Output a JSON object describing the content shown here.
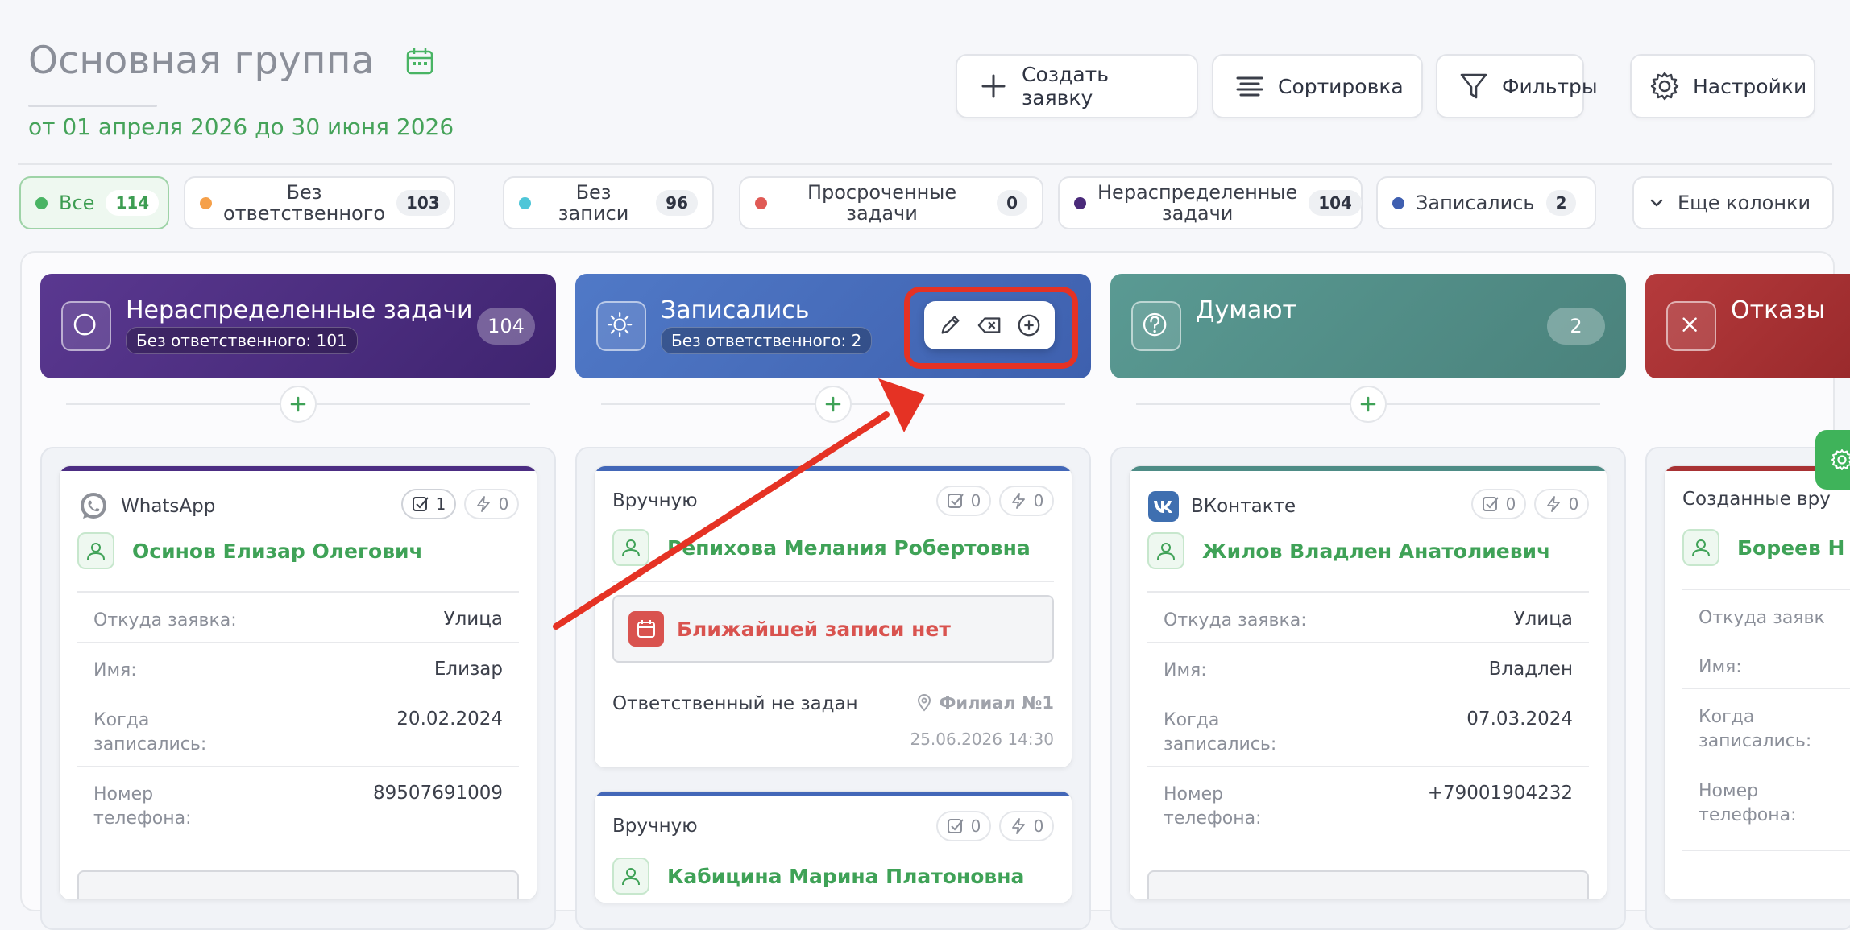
{
  "header": {
    "title": "Основная группа",
    "date_range": "от 01 апреля 2026 до 30 июня 2026"
  },
  "toolbar": {
    "create": "Создать заявку",
    "sort": "Сортировка",
    "filters": "Фильтры",
    "settings": "Настройки"
  },
  "chips": [
    {
      "label": "Все",
      "count": "114",
      "color": "#49b464"
    },
    {
      "label1": "Без",
      "label2": "ответственного",
      "count": "103",
      "color": "#f5a04a"
    },
    {
      "label": "Без записи",
      "count": "96",
      "color": "#4fc6d8"
    },
    {
      "label1": "Просроченные",
      "label2": "задачи",
      "count": "0",
      "color": "#e05a55"
    },
    {
      "label1": "Нераспределенные",
      "label2": "задачи",
      "count": "104",
      "color": "#4a2a7a"
    },
    {
      "label": "Записались",
      "count": "2",
      "color": "#3f5fb0"
    }
  ],
  "more_columns": "Еще колонки",
  "columns": [
    {
      "title": "Нераспределенные задачи",
      "sub": "Без ответственного: 101",
      "count": "104",
      "color": "#4c2d83"
    },
    {
      "title": "Записались",
      "sub": "Без ответственного: 2",
      "color": "#4367b8"
    },
    {
      "title": "Думают",
      "count": "2",
      "color": "#4e8c86"
    },
    {
      "title": "Отказы",
      "color": "#a83234"
    }
  ],
  "cards": {
    "c1": {
      "source": "WhatsApp",
      "tasks": "1",
      "events": "0",
      "name": "Осинов Елизар Олегович",
      "fields": [
        {
          "k1": "Откуда заявка:",
          "v": "Улица"
        },
        {
          "k1": "Имя:",
          "v": "Елизар"
        },
        {
          "k1": "Когда",
          "k2": "записались:",
          "v": "20.02.2024"
        },
        {
          "k1": "Номер",
          "k2": "телефона:",
          "v": "89507691009"
        }
      ]
    },
    "c2": {
      "source": "Вручную",
      "tasks": "0",
      "events": "0",
      "name": "Репихова Мелания Робертовна",
      "next": "Ближайшей записи нет",
      "responsible": "Ответственный не задан",
      "branch": "Филиал №1",
      "timestamp": "25.06.2026 14:30"
    },
    "c3": {
      "source": "Вручную",
      "tasks": "0",
      "events": "0",
      "name": "Кабицина Марина Платоновна"
    },
    "c4": {
      "source": "ВКонтакте",
      "tasks": "0",
      "events": "0",
      "name": "Жилов Владлен Анатолиевич",
      "fields": [
        {
          "k1": "Откуда заявка:",
          "v": "Улица"
        },
        {
          "k1": "Имя:",
          "v": "Владлен"
        },
        {
          "k1": "Когда",
          "k2": "записались:",
          "v": "07.03.2024"
        },
        {
          "k1": "Номер",
          "k2": "телефона:",
          "v": "+79001904232"
        }
      ]
    },
    "c5": {
      "source": "Созданные вру",
      "name": "Бореев Н",
      "fields": [
        {
          "k1": "Откуда заявк"
        },
        {
          "k1": "Имя:"
        },
        {
          "k1": "Когда",
          "k2": "записались:"
        },
        {
          "k1": "Номер",
          "k2": "телефона:"
        }
      ]
    }
  },
  "icons": {
    "calendar": "calendar-icon",
    "plus": "plus-icon",
    "sort": "sort-icon",
    "filter": "filter-icon",
    "gear": "gear-icon",
    "edit": "pencil-icon",
    "clear": "backspace-icon",
    "add": "plus-circle-icon"
  }
}
